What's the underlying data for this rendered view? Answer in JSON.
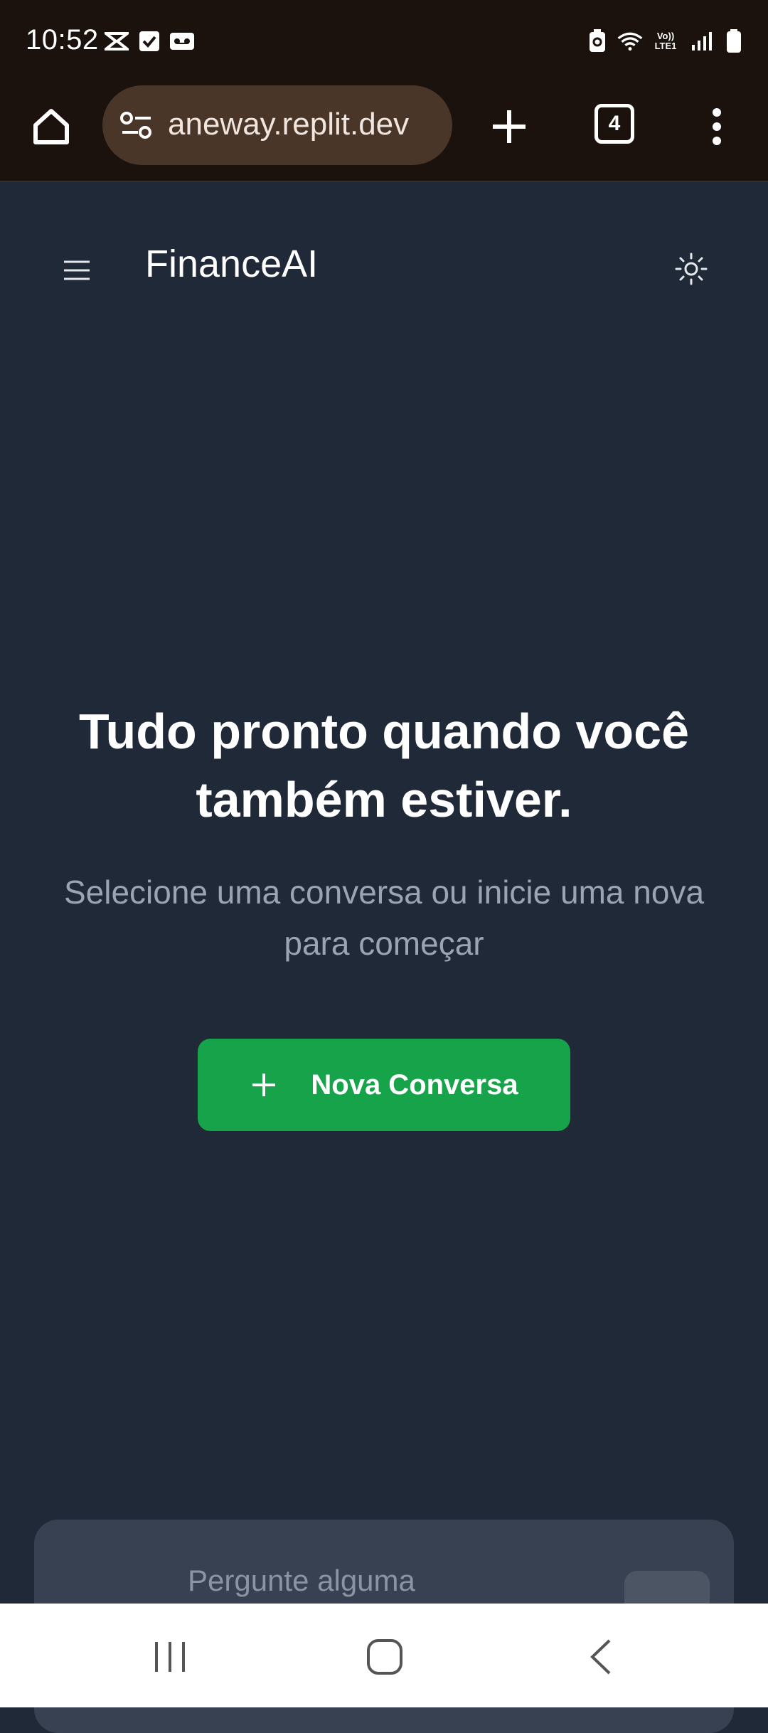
{
  "status_bar": {
    "time": "10:52",
    "left_icons": [
      "capcut-icon",
      "check-box-icon",
      "voicemail-icon"
    ],
    "right_icons": [
      "battery-saver-icon",
      "wifi-icon",
      "volte-lte-icon",
      "signal-icon",
      "battery-icon"
    ],
    "volte_label_top": "Vo))",
    "volte_label_bottom": "LTE1"
  },
  "browser": {
    "url": "aneway.replit.dev",
    "tab_count": "4"
  },
  "app": {
    "title": "FinanceAI"
  },
  "hero": {
    "title": "Tudo pronto quando você também estiver.",
    "subtitle": "Selecione uma conversa ou inicie uma nova para começar"
  },
  "new_chat_button": {
    "label": "Nova Conversa"
  },
  "composer": {
    "placeholder": "Pergunte alguma"
  },
  "colors": {
    "background": "#1f2937",
    "accent": "#16a34a",
    "browser_chrome": "#1b120e"
  }
}
